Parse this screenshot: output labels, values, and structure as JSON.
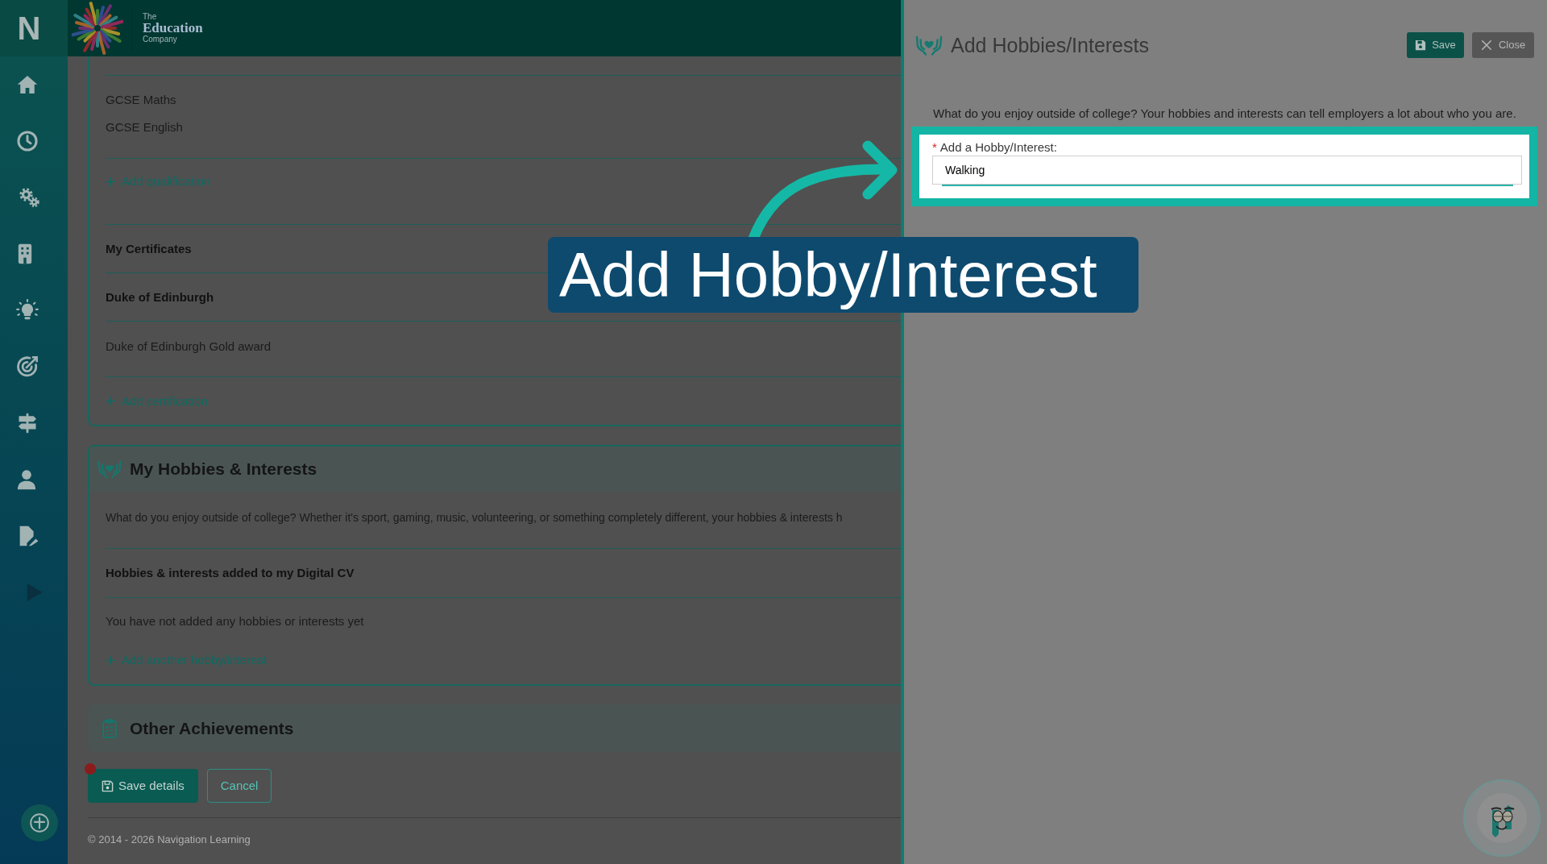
{
  "sidebar": {
    "logo": "N"
  },
  "header": {
    "brand_top": "The",
    "brand_name": "Education",
    "brand_bottom": "Company"
  },
  "cv_form": {
    "qualifications": {
      "items": [
        "GCSE Maths",
        "GCSE English"
      ],
      "add_link": "Add qualification"
    },
    "certificates": {
      "heading": "My Certificates",
      "groups": [
        {
          "title": "Duke of Edinburgh",
          "items": [
            "Duke of Edinburgh Gold award"
          ]
        }
      ],
      "add_link": "Add certification"
    },
    "hobbies": {
      "title": "My Hobbies & Interests",
      "intro": "What do you enjoy outside of college? Whether it's sport, gaming, music, volunteering, or something completely different, your hobbies & interests h",
      "list_heading": "Hobbies & interests added to my Digital CV",
      "empty_message": "You have not added any hobbies or interests yet",
      "add_link": "Add another hobby/interest"
    },
    "other_achievements": {
      "title": "Other Achievements"
    },
    "buttons": [
      {
        "label": "Save details",
        "kind": "primary",
        "alert": true
      },
      {
        "label": "Cancel",
        "kind": "secondary",
        "alert": false
      }
    ]
  },
  "footer": {
    "copyright": "© 2014 - 2026 Navigation Learning"
  },
  "drawer": {
    "title": "Add Hobbies/Interests",
    "buttons": [
      {
        "label": "Save",
        "kind": "save"
      },
      {
        "label": "Close",
        "kind": "close"
      }
    ],
    "intro": "What do you enjoy outside of college? Your hobbies and interests can tell employers a lot about who you are.",
    "field": {
      "required_mark": "*",
      "label": "Add a Hobby/Interest:",
      "value": "Walking",
      "highlighted": true
    }
  },
  "annotation": {
    "text": "Add Hobby/Interest"
  }
}
